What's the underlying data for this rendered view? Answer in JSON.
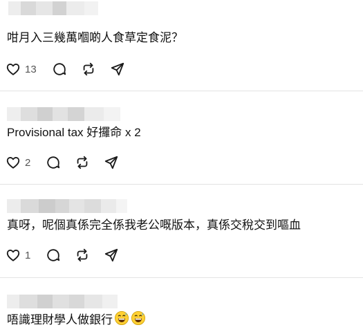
{
  "comments": [
    {
      "username": "",
      "text": "咁月入三幾萬嗰啲人食草定食泥？",
      "likes": "13",
      "icons": [
        "heart-icon",
        "comment-icon",
        "repost-icon",
        "share-icon"
      ],
      "emoji": []
    },
    {
      "username": "",
      "text": "Provisional tax 好攞命 x 2",
      "likes": "2",
      "icons": [
        "heart-icon",
        "comment-icon",
        "repost-icon",
        "share-icon"
      ],
      "emoji": []
    },
    {
      "username": "",
      "text": "真呀，呢個真係完全係我老公嘅版本，真係交稅交到嘔血",
      "likes": "1",
      "icons": [
        "heart-icon",
        "comment-icon",
        "repost-icon",
        "share-icon"
      ],
      "emoji": []
    },
    {
      "username": "",
      "text": "唔識理財學人做銀行",
      "likes": "",
      "icons": [],
      "emoji": [
        "grinning-sweat-emoji",
        "grinning-sweat-emoji"
      ]
    }
  ],
  "colors": {
    "text": "#111111",
    "icon": "#1a1a1a",
    "divider": "#e3e3e3",
    "blur_light": "#e8e8e8",
    "blur_dark": "#cfcfcf",
    "emoji_face": "#ffd034"
  }
}
